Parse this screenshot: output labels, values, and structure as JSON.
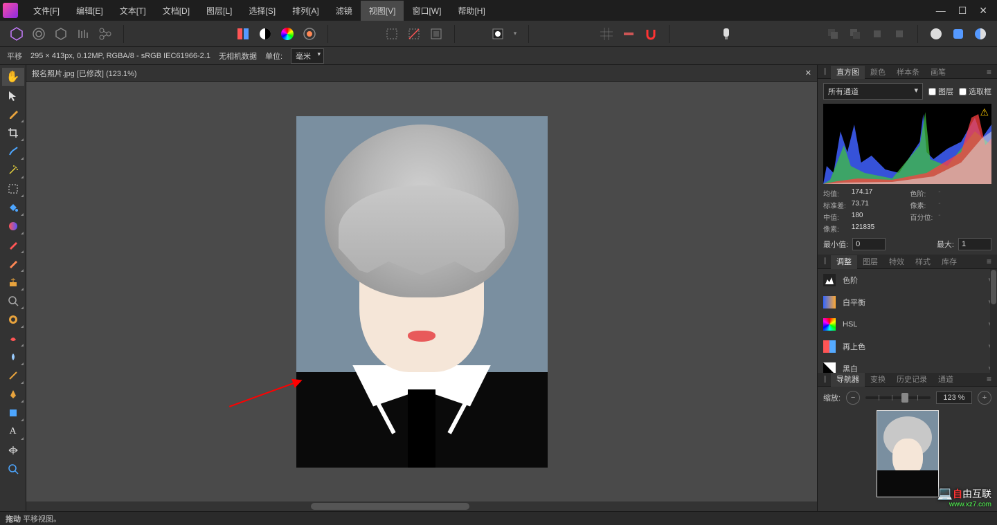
{
  "menu": [
    "文件[F]",
    "编辑[E]",
    "文本[T]",
    "文档[D]",
    "图层[L]",
    "选择[S]",
    "排列[A]",
    "滤镜",
    "视图[V]",
    "窗口[W]",
    "帮助[H]"
  ],
  "menu_active_index": 8,
  "context": {
    "tool": "平移",
    "info": "295 × 413px, 0.12MP, RGBA/8 - sRGB IEC61966-2.1",
    "camera": "无相机数据",
    "unit_label": "单位:",
    "unit_value": "毫米"
  },
  "doc": {
    "title": "报名照片.jpg [已修改] (123.1%)"
  },
  "tabs1": [
    "直方图",
    "颜色",
    "样本条",
    "画笔"
  ],
  "tabs1_active": 0,
  "histogram": {
    "channel": "所有通道",
    "layer_label": "图层",
    "selection_label": "选取框",
    "stats": {
      "mean_label": "均值:",
      "mean": "174.17",
      "std_label": "标准差:",
      "std": "73.71",
      "median_label": "中值:",
      "median": "180",
      "pixels_label": "像素:",
      "pixels": "121835",
      "level_label": "色阶:",
      "count_label": "像素:",
      "percent_label": "百分位:"
    },
    "min_label": "最小值:",
    "min": "0",
    "max_label": "最大:",
    "max": "1"
  },
  "tabs2": [
    "调整",
    "图层",
    "特效",
    "样式",
    "库存"
  ],
  "tabs2_active": 0,
  "adjustments": [
    {
      "name": "色阶",
      "icon": "levels"
    },
    {
      "name": "白平衡",
      "icon": "wb"
    },
    {
      "name": "HSL",
      "icon": "hsl"
    },
    {
      "name": "再上色",
      "icon": "recolor"
    },
    {
      "name": "黑白",
      "icon": "bw"
    }
  ],
  "tabs3": [
    "导航器",
    "变换",
    "历史记录",
    "通道"
  ],
  "tabs3_active": 0,
  "nav": {
    "zoom_label": "缩放:",
    "zoom_value": "123 %"
  },
  "status": {
    "action": "拖动",
    "desc": "平移视图。"
  },
  "watermark": {
    "brand": "由互联",
    "url": "www.xz7.com"
  }
}
